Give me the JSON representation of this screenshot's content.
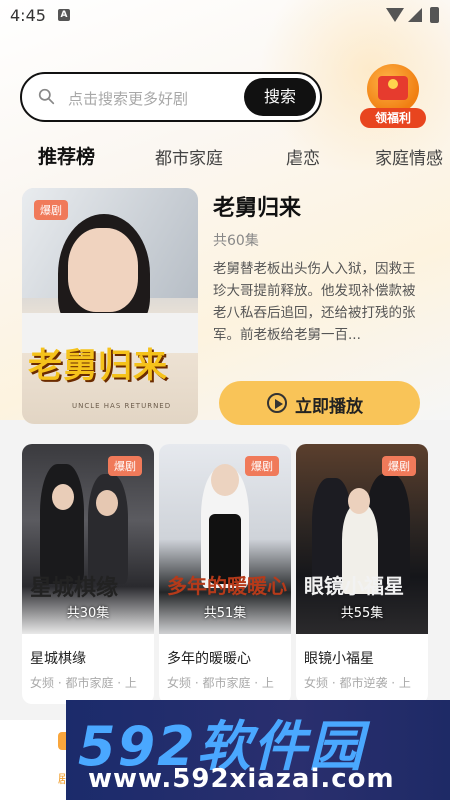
{
  "status_bar": {
    "time": "4:45",
    "app_icon_letter": "A"
  },
  "search": {
    "placeholder": "点击搜索更多好剧",
    "button_label": "搜索"
  },
  "welfare": {
    "label": "领福利"
  },
  "tabs": [
    {
      "label": "推荐榜",
      "active": true
    },
    {
      "label": "都市家庭",
      "active": false
    },
    {
      "label": "虐恋",
      "active": false
    },
    {
      "label": "家庭情感",
      "active": false
    }
  ],
  "featured": {
    "badge": "爆剧",
    "poster_title": "老舅归来",
    "poster_subtitle": "UNCLE HAS RETURNED",
    "title": "老舅归来",
    "episodes": "共60集",
    "description": "老舅替老板出头伤人入狱，因救王珍大哥提前释放。他发现补偿款被老八私吞后追回，还给被打残的张军。前老板给老舅一百...",
    "play_label": "立即播放"
  },
  "cards": [
    {
      "badge": "爆剧",
      "poster_title": "星城棋缘",
      "episodes": "共30集",
      "name": "星城棋缘",
      "tags": "女频 · 都市家庭 · 上"
    },
    {
      "badge": "爆剧",
      "poster_title": "多年的暖暖心",
      "episodes": "共51集",
      "name": "多年的暖暖心",
      "tags": "女频 · 都市家庭 · 上"
    },
    {
      "badge": "爆剧",
      "poster_title": "眼镜小福星",
      "episodes": "共55集",
      "name": "眼镜小福星",
      "tags": "女频 · 都市逆袭 · 上"
    }
  ],
  "bottom_nav": {
    "partial_label": "剧"
  },
  "watermark": {
    "brand": "592软件园",
    "url": "www.592xiazai.com"
  },
  "colors": {
    "accent": "#f9c458",
    "badge": "#f07a5a",
    "search_btn": "#111111"
  }
}
